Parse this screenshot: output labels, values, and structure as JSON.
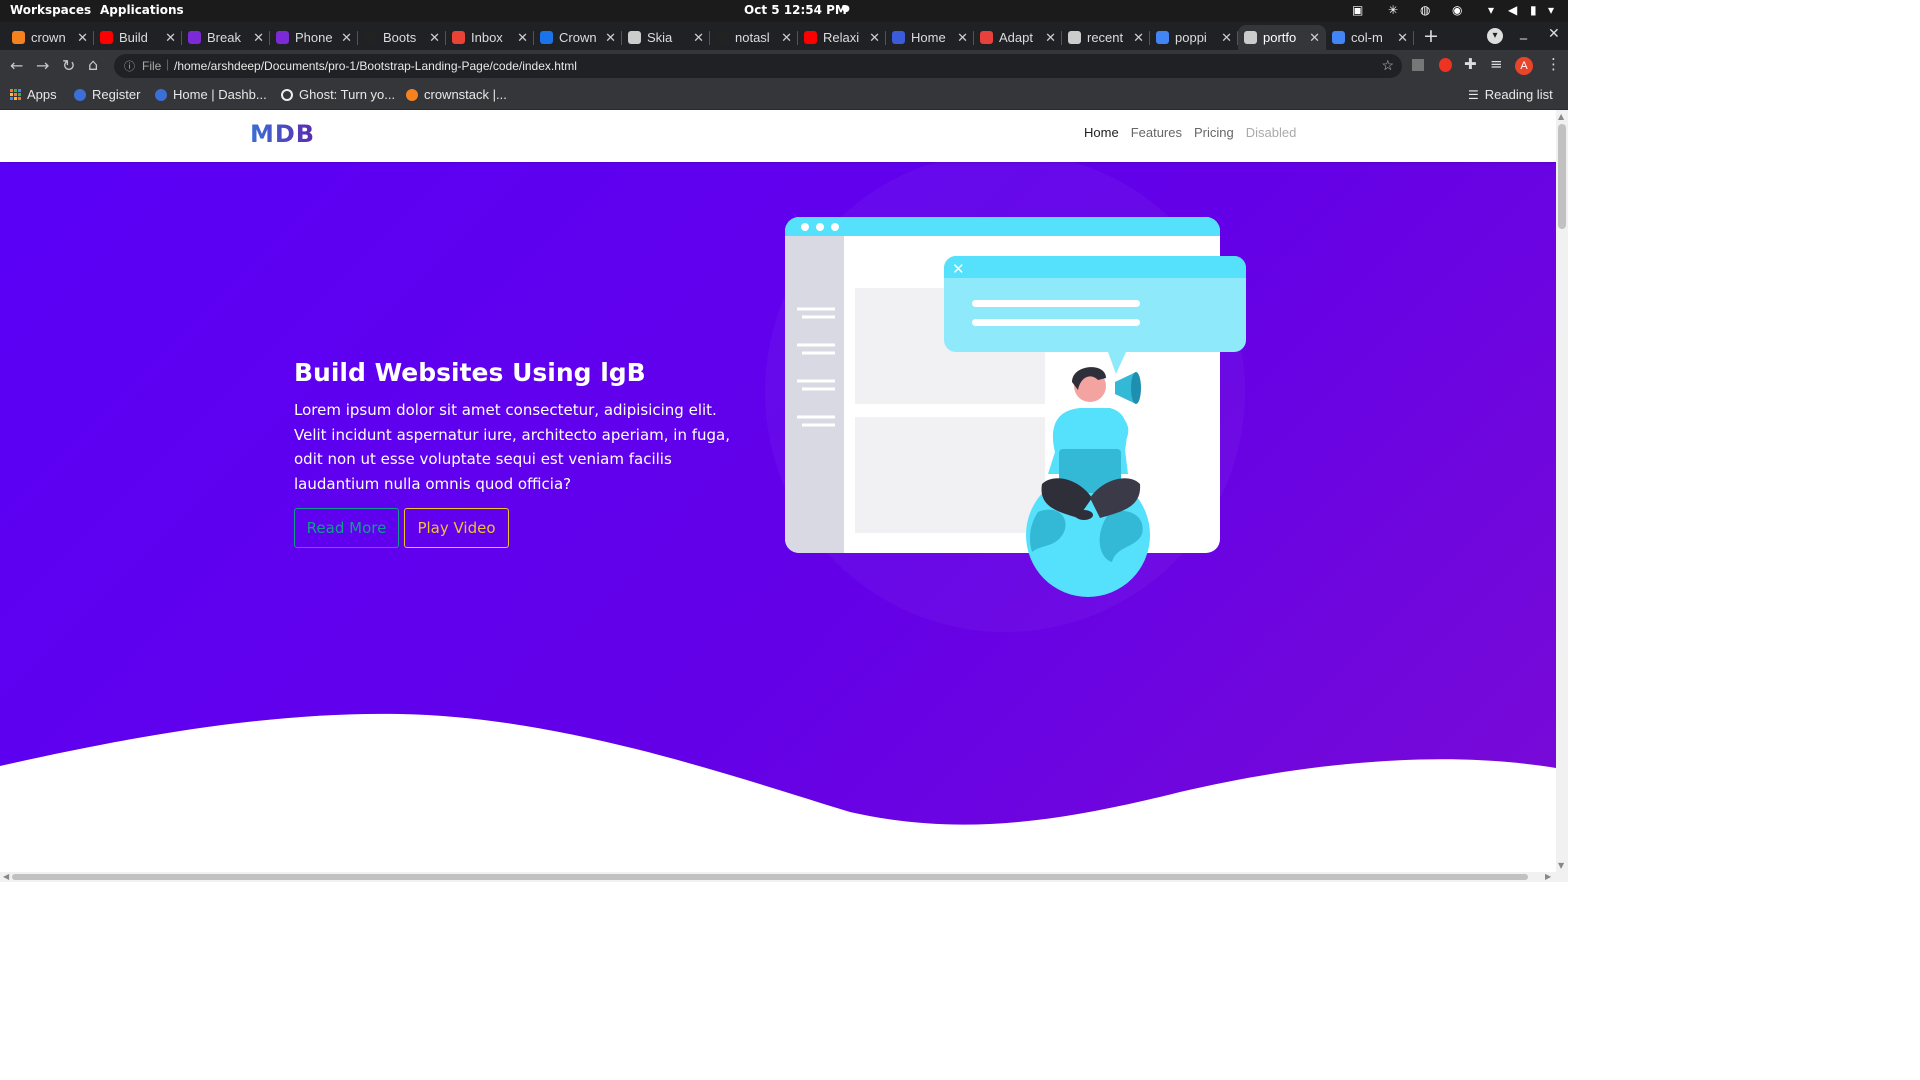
{
  "system": {
    "workspaces": "Workspaces",
    "applications": "Applications",
    "clock": "Oct 5  12:54 PM"
  },
  "tabs": [
    {
      "label": "crown",
      "icon": "crownstack-icon",
      "color": "#f5821f"
    },
    {
      "label": "Build",
      "icon": "youtube-icon",
      "color": "#ff0000"
    },
    {
      "label": "Break",
      "icon": "bootstrap-icon",
      "color": "#7b2ad6"
    },
    {
      "label": "Phone",
      "icon": "bootstrap-icon",
      "color": "#7b2ad6"
    },
    {
      "label": "Boots",
      "icon": "github-icon",
      "color": "#222222"
    },
    {
      "label": "Inbox",
      "icon": "gmail-icon",
      "color": "#ea4335"
    },
    {
      "label": "Crown",
      "icon": "google-slides-icon",
      "color": "#1a73e8"
    },
    {
      "label": "Skia",
      "icon": "globe-icon",
      "color": "#cccccc"
    },
    {
      "label": "notasl",
      "icon": "github-icon",
      "color": "#222222"
    },
    {
      "label": "Relaxi",
      "icon": "youtube-icon",
      "color": "#ff0000"
    },
    {
      "label": "Home",
      "icon": "kanban-k-icon",
      "color": "#3b5bdb"
    },
    {
      "label": "Adapt",
      "icon": "asterisk-icon",
      "color": "#e8403a"
    },
    {
      "label": "recent",
      "icon": "globe-icon",
      "color": "#cccccc"
    },
    {
      "label": "poppi",
      "icon": "google-icon",
      "color": "#4285f4"
    },
    {
      "label": "portfo",
      "icon": "globe-icon",
      "color": "#cccccc",
      "active": true
    },
    {
      "label": "col-m",
      "icon": "google-icon",
      "color": "#4285f4"
    }
  ],
  "addressbar": {
    "scheme_label": "File",
    "url": "/home/arshdeep/Documents/pro-1/Bootstrap-Landing-Page/code/index.html",
    "profile_initial": "A"
  },
  "bookmarks": {
    "apps": "Apps",
    "items": [
      "Register",
      "Home | Dashb...",
      "Ghost: Turn yo...",
      "crownstack |..."
    ],
    "reading_list": "Reading list"
  },
  "site": {
    "brand": "MDB",
    "nav": [
      {
        "label": "Home",
        "state": "active",
        "color": "#212121"
      },
      {
        "label": "Features",
        "state": "normal",
        "color": "#666666"
      },
      {
        "label": "Pricing",
        "state": "normal",
        "color": "#666666"
      },
      {
        "label": "Disabled",
        "state": "disabled",
        "color": "#aaaaaa"
      }
    ],
    "hero": {
      "title": "Build Websites Using lgB",
      "text": "Lorem ipsum dolor sit amet consectetur, adipisicing elit. Velit incidunt aspernatur iure, architecto aperiam, in fuga, odit non ut esse voluptate sequi est veniam facilis laudantium nulla omnis quod officia?",
      "read_more": "Read More",
      "play_video": "Play Video"
    }
  },
  "colors": {
    "hero_start": "#5a00f7",
    "hero_end": "#7a0bd6",
    "illustration_cyan": "#55e0fb",
    "read_more": "#0e9f8a",
    "play_video": "#f2c230"
  }
}
